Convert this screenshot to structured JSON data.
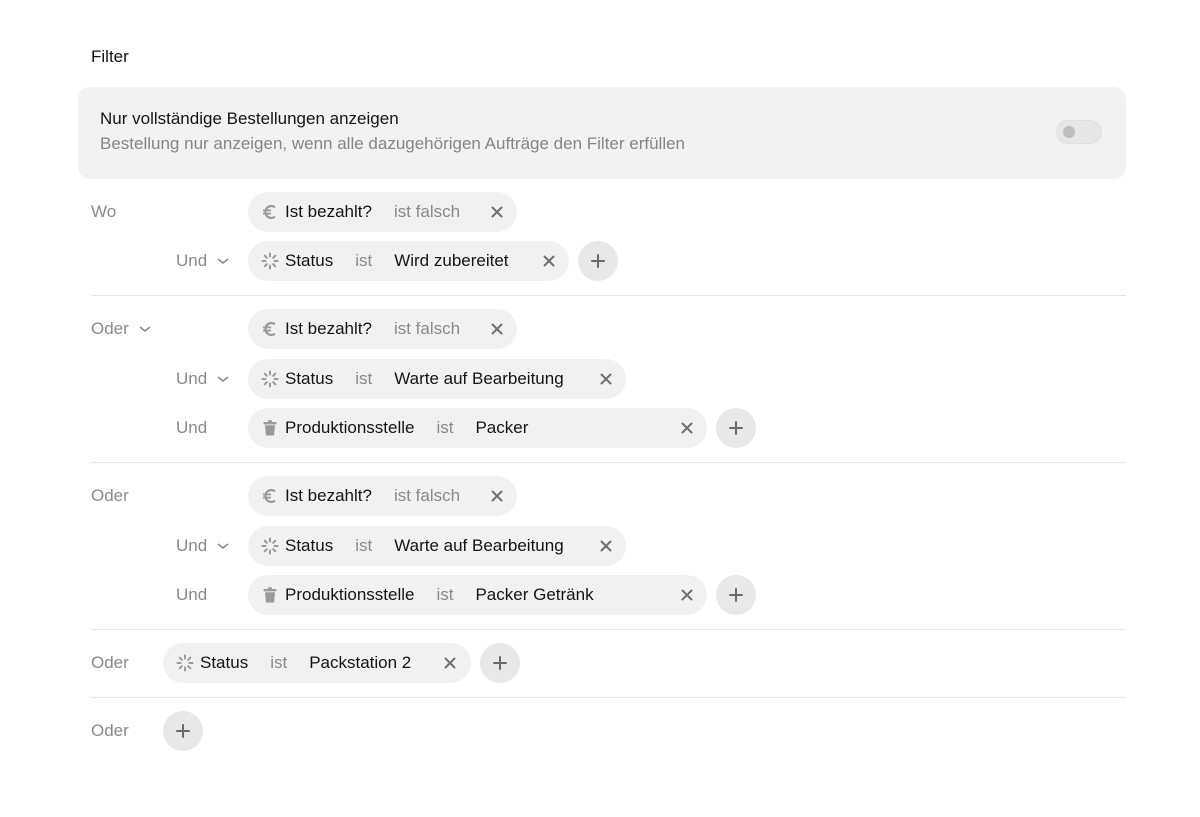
{
  "heading": "Filter",
  "toggle": {
    "title": "Nur vollständige Bestellungen anzeigen",
    "description": "Bestellung nur anzeigen, wenn alle dazugehörigen Aufträge den Filter erfüllen",
    "enabled": false
  },
  "conjunctions": {
    "where": "Wo",
    "and": "Und",
    "or": "Oder"
  },
  "groups": [
    {
      "conditions": [
        {
          "icon": "euro-icon",
          "field": "Ist bezahlt?",
          "operator": "ist falsch"
        },
        {
          "icon": "loading-spinner-icon",
          "field": "Status",
          "operator": "ist",
          "value": "Wird zubereitet"
        }
      ]
    },
    {
      "conditions": [
        {
          "icon": "euro-icon",
          "field": "Ist bezahlt?",
          "operator": "ist falsch"
        },
        {
          "icon": "loading-spinner-icon",
          "field": "Status",
          "operator": "ist",
          "value": "Warte auf Bearbeitung"
        },
        {
          "icon": "trash-icon",
          "field": "Produktionsstelle",
          "operator": "ist",
          "value": "Packer"
        }
      ]
    },
    {
      "conditions": [
        {
          "icon": "euro-icon",
          "field": "Ist bezahlt?",
          "operator": "ist falsch"
        },
        {
          "icon": "loading-spinner-icon",
          "field": "Status",
          "operator": "ist",
          "value": "Warte auf Bearbeitung"
        },
        {
          "icon": "trash-icon",
          "field": "Produktionsstelle",
          "operator": "ist",
          "value": "Packer Getränk"
        }
      ]
    },
    {
      "conditions": [
        {
          "icon": "loading-spinner-icon",
          "field": "Status",
          "operator": "ist",
          "value": "Packstation 2"
        }
      ]
    },
    {
      "conditions": []
    }
  ]
}
